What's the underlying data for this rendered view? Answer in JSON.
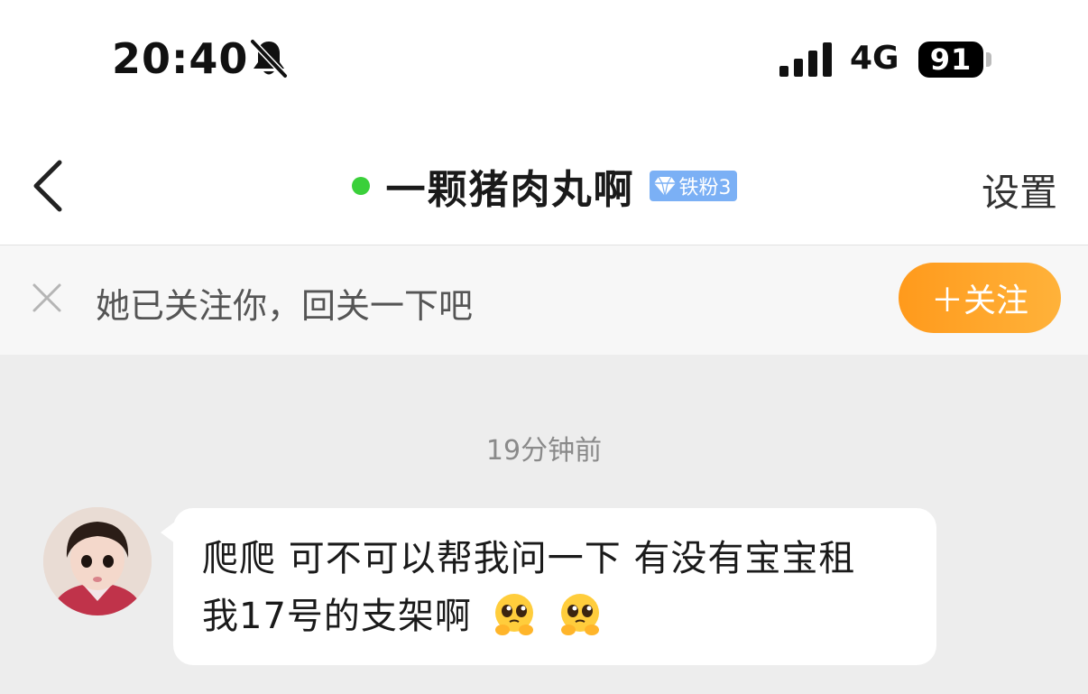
{
  "status_bar": {
    "time": "20:40",
    "network": "4G",
    "battery": "91",
    "icons": [
      "bell-muted-icon",
      "signal-icon",
      "battery-icon"
    ]
  },
  "header": {
    "title": "一颗猪肉丸啊",
    "badge": "铁粉3",
    "settings_label": "设置",
    "online_color": "#3ad03a",
    "badge_color": "#7bb0f5"
  },
  "follow_bar": {
    "message": "她已关注你，回关一下吧",
    "button_label": "＋关注",
    "button_color": "#ff9a1c"
  },
  "chat": {
    "timestamp": "19分钟前",
    "messages": [
      {
        "sender": "other",
        "text": "爬爬 可不可以帮我问一下 有没有宝宝租我17号的支架啊",
        "emojis": [
          "pleading-face-icon",
          "pleading-face-icon"
        ]
      }
    ]
  }
}
